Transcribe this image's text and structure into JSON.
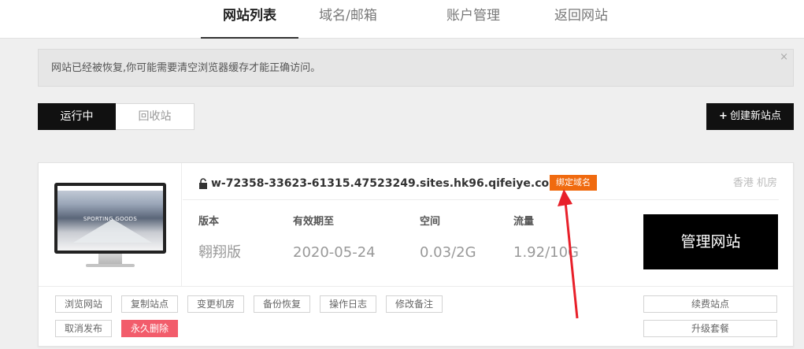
{
  "nav": {
    "tabs": [
      {
        "label": "网站列表"
      },
      {
        "label": "域名/邮箱"
      },
      {
        "label": "账户管理"
      },
      {
        "label": "返回网站"
      }
    ]
  },
  "notice": {
    "text": "网站已经被恢复,你可能需要清空浏览器缓存才能正确访问。",
    "close": "×"
  },
  "filter": {
    "running": "运行中",
    "recycle": "回收站"
  },
  "create_button": {
    "icon": "plus-icon",
    "plus": "+",
    "label": "创建新站点"
  },
  "site": {
    "thumb_title": "SPORTING GOODS",
    "domain": "w-72358-33623-61315.47523249.sites.hk96.qifeiye.com",
    "bind_domain": "绑定域名",
    "location": "香港 机房",
    "stats": {
      "version_label": "版本",
      "version_value": "翱翔版",
      "expiry_label": "有效期至",
      "expiry_value": "2020-05-24",
      "space_label": "空间",
      "space_value": "0.03/2G",
      "traffic_label": "流量",
      "traffic_value": "1.92/10G"
    },
    "manage": "管理网站",
    "actions": [
      {
        "label": "浏览网站"
      },
      {
        "label": "复制站点"
      },
      {
        "label": "变更机房"
      },
      {
        "label": "备份恢复"
      },
      {
        "label": "操作日志"
      },
      {
        "label": "修改备注"
      },
      {
        "label": "取消发布"
      },
      {
        "label": "永久删除"
      }
    ],
    "renew": "续费站点",
    "upgrade": "升级套餐"
  },
  "colors": {
    "accent_black": "#111111",
    "bind_orange": "#f06a0f",
    "danger_red": "#f25c6b",
    "arrow_red": "#e8202a"
  }
}
